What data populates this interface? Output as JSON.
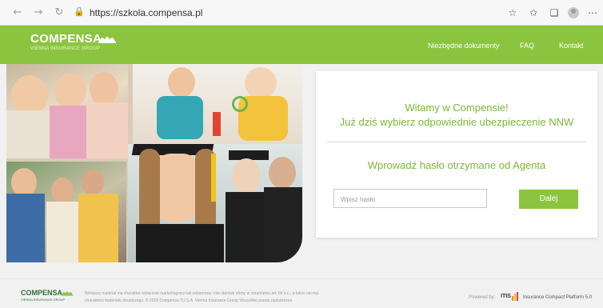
{
  "browser": {
    "url": "https://szkola.compensa.pl",
    "icons": [
      "back-arrow-icon",
      "forward-arrow-icon",
      "reload-icon",
      "lock-icon",
      "star-icon",
      "favorites-icon",
      "collections-icon",
      "profile-icon",
      "more-icon"
    ]
  },
  "header": {
    "logo_word": "COMPENSA",
    "logo_sub": "VIENNA INSURANCE GROUP",
    "nav": [
      "Niezbędne dokumenty",
      "FAQ",
      "Kontakt"
    ]
  },
  "login": {
    "welcome_line1": "Witamy w Compensie!",
    "welcome_line2": "Już dziś wybierz odpowiednie ubezpieczenie NNW",
    "prompt": "Wprowadź hasło otrzymane od Agenta",
    "password_placeholder": "Wpisz hasło",
    "submit": "Dalej"
  },
  "footer": {
    "logo_word": "COMPENSA",
    "logo_sub": "VIENNA INSURANCE GROUP",
    "disclaimer_line1": "Niniejszy materiał ma charakter wyłącznie marketingowy lub reklamowy i nie stanowi oferty w rozumieniu art. 66 k.c., a także nie ma",
    "disclaimer_line2": "charakteru materiału doradczego. © 2019 Compensa TU S.A. Vienna Insurance Group Wszystkie prawa zastrzeżone.",
    "powered_by": "Powered by:",
    "itis": "ITIS",
    "platform": "Insurance Compact Platform 5.0"
  },
  "colors": {
    "brand_green": "#8bc53f",
    "text_green": "#79b934"
  }
}
